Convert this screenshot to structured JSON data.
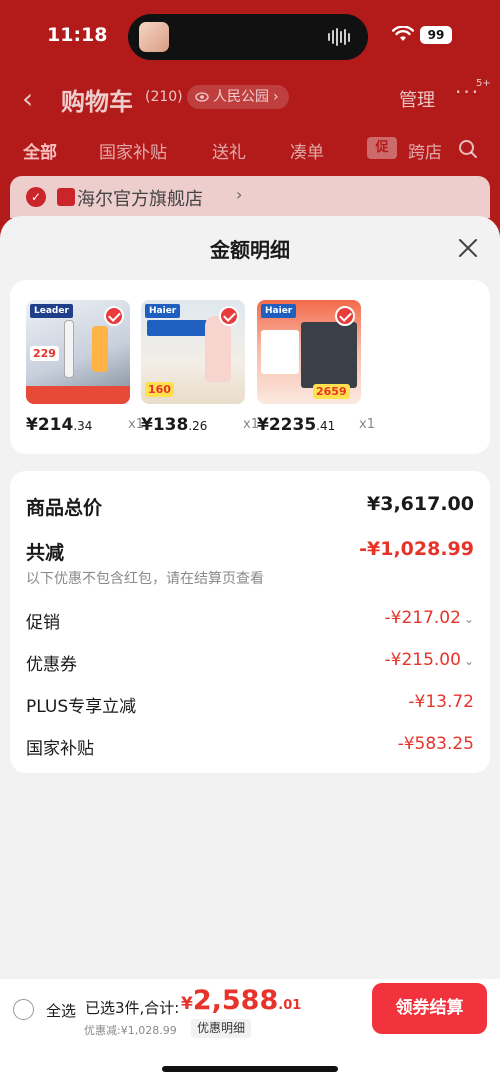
{
  "status_bar": {
    "time": "11:18",
    "battery": "99"
  },
  "header": {
    "back_icon": "chevron-left-icon",
    "title": "购物车",
    "count": "(210)",
    "location": "人民公园",
    "manage": "管理",
    "more_badge": "5+"
  },
  "tabs": [
    {
      "label": "全部"
    },
    {
      "label": "国家补贴"
    },
    {
      "label": "送礼"
    },
    {
      "label": "凑单"
    },
    {
      "label": "跨店"
    }
  ],
  "promo_badge": "促",
  "store": {
    "name": "海尔官方旗舰店"
  },
  "sheet": {
    "title": "金额明细",
    "products": [
      {
        "brand": "Leader",
        "price_int": "¥214",
        "price_cents": ".34",
        "qty": "x1",
        "tag": "229"
      },
      {
        "brand": "Haier",
        "price_int": "¥138",
        "price_cents": ".26",
        "qty": "x1",
        "tag": "160"
      },
      {
        "brand": "Haier",
        "price_int": "¥2235",
        "price_cents": ".41",
        "qty": "x1",
        "tag": "2659"
      }
    ],
    "summary": {
      "goods_total_label": "商品总价",
      "goods_total_value": "¥3,617.00",
      "total_discount_label": "共减",
      "total_discount_value": "-¥1,028.99",
      "note": "以下优惠不包含红包，请在结算页查看",
      "rows": [
        {
          "label": "促销",
          "value": "-¥217.02"
        },
        {
          "label": "优惠券",
          "value": "-¥215.00"
        },
        {
          "label": "PLUS专享立减",
          "value": "-¥13.72"
        },
        {
          "label": "国家补贴",
          "value": "-¥583.25"
        }
      ]
    }
  },
  "bottom": {
    "select_all": "全选",
    "selected_info": "已选3件,合计:",
    "total_yen": "¥",
    "total_int": "2,588",
    "total_cents": ".01",
    "discount_line": "优惠减:¥1,028.99",
    "detail_chip": "优惠明细",
    "checkout": "领券结算"
  },
  "colors": {
    "accent_red": "#e8332a",
    "header_red": "#b31b1b",
    "button_red": "#f2323c"
  }
}
